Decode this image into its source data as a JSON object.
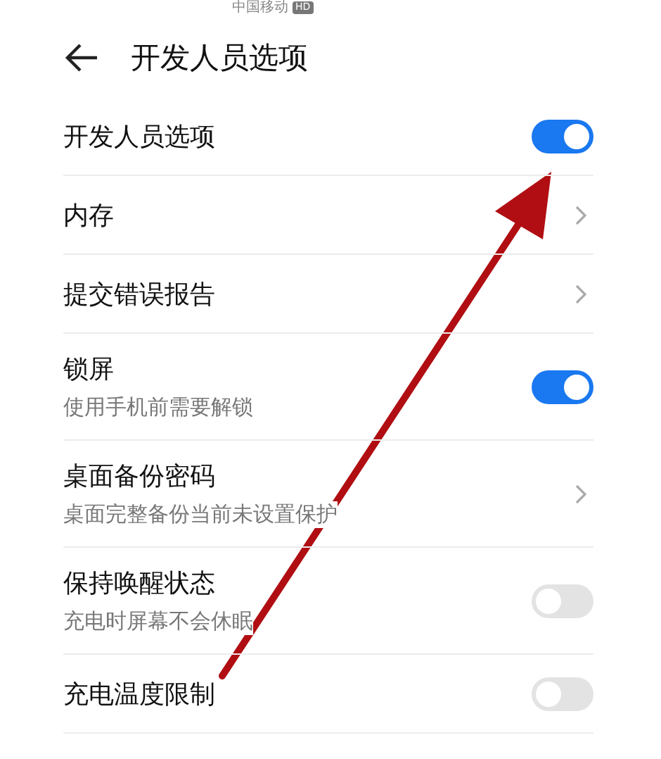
{
  "status_bar": {
    "carrier": "中国移动",
    "badge": "HD"
  },
  "header": {
    "title": "开发人员选项"
  },
  "rows": [
    {
      "title": "开发人员选项",
      "kind": "toggle",
      "on": true
    },
    {
      "title": "内存",
      "kind": "link"
    },
    {
      "title": "提交错误报告",
      "kind": "link"
    },
    {
      "title": "锁屏",
      "subtitle": "使用手机前需要解锁",
      "kind": "toggle",
      "on": true
    },
    {
      "title": "桌面备份密码",
      "subtitle": "桌面完整备份当前未设置保护",
      "kind": "link"
    },
    {
      "title": "保持唤醒状态",
      "subtitle": "充电时屏幕不会休眠",
      "kind": "toggle",
      "on": false
    },
    {
      "title": "充电温度限制",
      "kind": "toggle",
      "on": false
    }
  ]
}
